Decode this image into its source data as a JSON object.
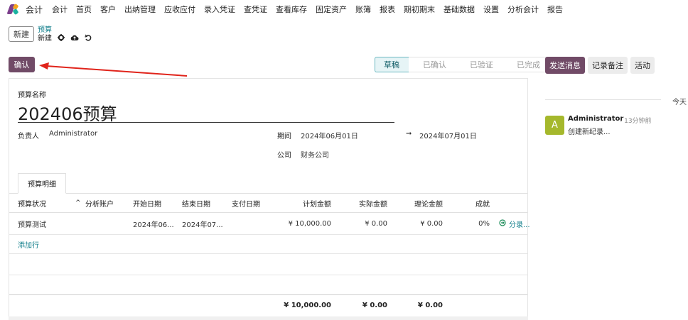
{
  "topnav": {
    "app_title": "会计",
    "menu": [
      "会计",
      "首页",
      "客户",
      "出纳管理",
      "应收应付",
      "录入凭证",
      "查凭证",
      "查看库存",
      "固定资产",
      "账簿",
      "报表",
      "期初期末",
      "基础数据",
      "设置",
      "分析会计",
      "报告"
    ]
  },
  "breadcrumb": {
    "new_label": "新建",
    "parent": "预算",
    "current": "新建"
  },
  "actions": {
    "confirm_label": "确认"
  },
  "status": {
    "stages": [
      "草稿",
      "已确认",
      "已验证",
      "已完成"
    ],
    "active": "草稿"
  },
  "form": {
    "name_label": "预算名称",
    "name_value": "202406预算",
    "owner_label": "负责人",
    "owner_value": "Administrator",
    "period_label": "期间",
    "period_start": "2024年06月01日",
    "period_arrow": "➞",
    "period_end": "2024年07月01日",
    "company_label": "公司",
    "company_value": "财务公司",
    "tab_label": "预算明细"
  },
  "table": {
    "headers": [
      "预算状况",
      "分析账户",
      "开始日期",
      "结束日期",
      "支付日期",
      "计划金额",
      "实际金额",
      "理论金额",
      "成就"
    ],
    "sort_glyph": "^",
    "rows": [
      {
        "status": "预算测试",
        "analytic": "",
        "start": "2024年06...",
        "end": "2024年07...",
        "pay": "",
        "planned": "¥ 10,000.00",
        "actual": "¥ 0.00",
        "theoretical": "¥ 0.00",
        "achieve": "0%",
        "link": "分录..."
      }
    ],
    "add_row": "添加行",
    "totals": {
      "planned": "¥ 10,000.00",
      "actual": "¥ 0.00",
      "theoretical": "¥ 0.00"
    }
  },
  "chatter": {
    "send_message": "发送消息",
    "log_note": "记录备注",
    "activity": "活动",
    "today": "今天",
    "avatar_letter": "A",
    "author": "Administrator",
    "time": "- 13分钟前",
    "body": "创建新纪录..."
  },
  "colors": {
    "brand": "#714b67",
    "accent": "#0f7d8a",
    "arrow": "#e0241b"
  }
}
